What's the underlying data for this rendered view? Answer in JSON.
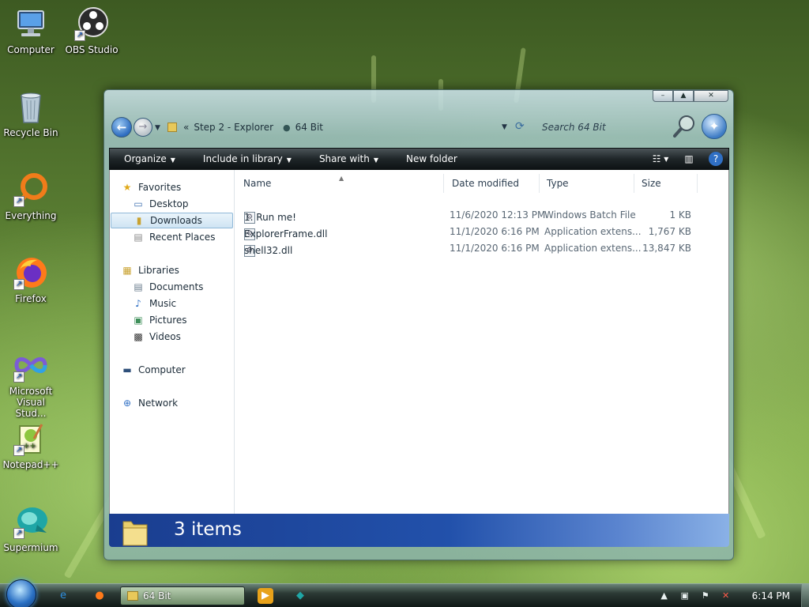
{
  "desktop": {
    "icons": [
      {
        "label": "Computer"
      },
      {
        "label": "OBS Studio"
      },
      {
        "label": "Recycle Bin"
      },
      {
        "label": "Everything"
      },
      {
        "label": "Firefox"
      },
      {
        "label_line1": "Microsoft",
        "label_line2": "Visual Stud..."
      },
      {
        "label": "Notepad++"
      },
      {
        "label": "Supermium"
      }
    ]
  },
  "window": {
    "caption": {
      "minimize": "–",
      "maximize": "▲",
      "close": "✕"
    },
    "address": {
      "parent_crumb": "Step 2 - Explorer",
      "current_crumb": "64 Bit",
      "overflow": "«"
    },
    "search_placeholder": "Search 64 Bit",
    "toolbar": {
      "organize": "Organize",
      "include_in_library": "Include in library",
      "share_with": "Share with",
      "new_folder": "New folder"
    },
    "nav": {
      "favorites": "Favorites",
      "desktop": "Desktop",
      "downloads": "Downloads",
      "recent_places": "Recent Places",
      "libraries": "Libraries",
      "documents": "Documents",
      "music": "Music",
      "pictures": "Pictures",
      "videos": "Videos",
      "computer": "Computer",
      "network": "Network"
    },
    "columns": {
      "name": "Name",
      "date_modified": "Date modified",
      "type": "Type",
      "size": "Size"
    },
    "files": [
      {
        "name": "1. Run me!",
        "date": "11/6/2020 12:13 PM",
        "type": "Windows Batch File",
        "size": "1 KB"
      },
      {
        "name": "ExplorerFrame.dll",
        "date": "11/1/2020 6:16 PM",
        "type": "Application extens...",
        "size": "1,767 KB"
      },
      {
        "name": "shell32.dll",
        "date": "11/1/2020 6:16 PM",
        "type": "Application extens...",
        "size": "13,847 KB"
      }
    ],
    "details": {
      "count": "3 items"
    }
  },
  "taskbar": {
    "task_button": "64 Bit",
    "clock": "6:14 PM"
  },
  "colors": {
    "accent": "#2251ab",
    "command_bar": "#1f2629",
    "selection": "#cfe4f3"
  }
}
